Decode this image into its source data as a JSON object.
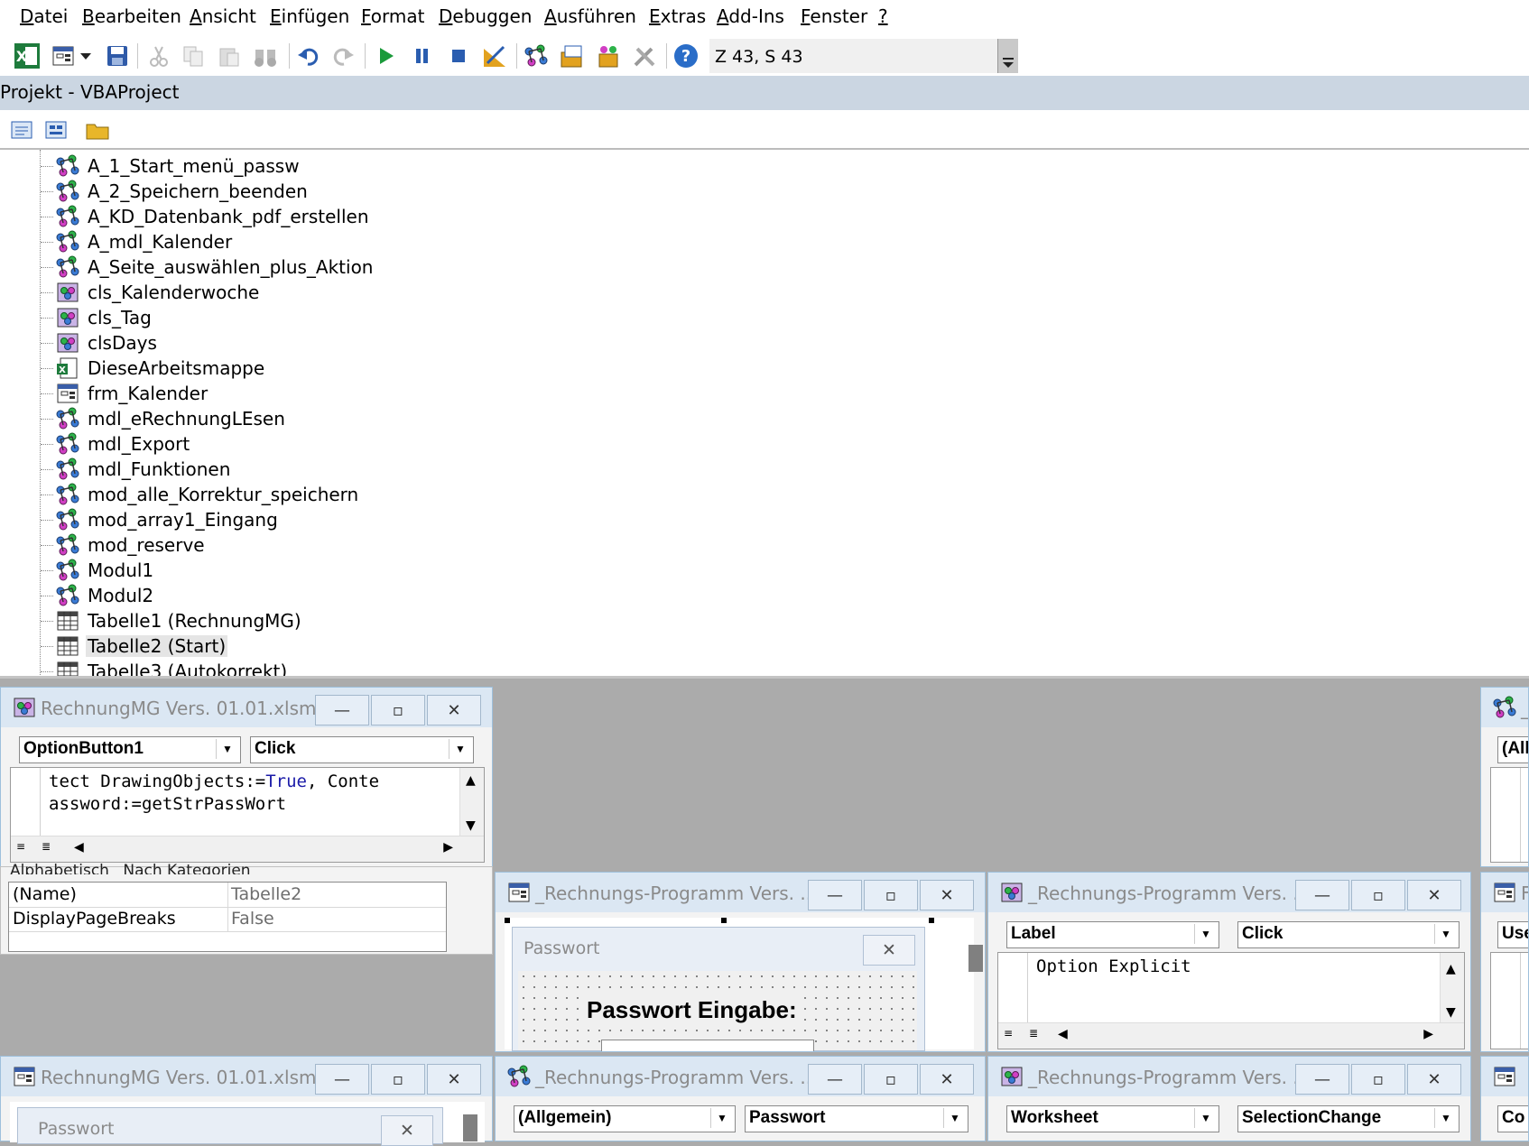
{
  "menu": [
    "Datei",
    "Bearbeiten",
    "Ansicht",
    "Einfügen",
    "Format",
    "Debuggen",
    "Ausführen",
    "Extras",
    "Add-Ins",
    "Fenster",
    "?"
  ],
  "menu_mnemonic": [
    "D",
    "B",
    "A",
    "E",
    "F",
    "D",
    "A",
    "E",
    "A",
    "F",
    "?"
  ],
  "toolbar": {
    "position": "Z 43, S 43"
  },
  "project": {
    "title": "Projekt - VBAProject",
    "items": [
      {
        "label": "A_1_Start_menü_passw",
        "icon": "module-icon"
      },
      {
        "label": "A_2_Speichern_beenden",
        "icon": "module-icon"
      },
      {
        "label": "A_KD_Datenbank_pdf_erstellen",
        "icon": "module-icon"
      },
      {
        "label": "A_mdl_Kalender",
        "icon": "module-icon"
      },
      {
        "label": "A_Seite_auswählen_plus_Aktion",
        "icon": "module-icon"
      },
      {
        "label": "cls_Kalenderwoche",
        "icon": "class-module-icon"
      },
      {
        "label": "cls_Tag",
        "icon": "class-module-icon"
      },
      {
        "label": "clsDays",
        "icon": "class-module-icon"
      },
      {
        "label": "DieseArbeitsmappe",
        "icon": "workbook-icon"
      },
      {
        "label": "frm_Kalender",
        "icon": "userform-icon"
      },
      {
        "label": "mdl_eRechnungLEsen",
        "icon": "module-icon"
      },
      {
        "label": "mdl_Export",
        "icon": "module-icon"
      },
      {
        "label": "mdl_Funktionen",
        "icon": "module-icon"
      },
      {
        "label": "mod_alle_Korrektur_speichern",
        "icon": "module-icon"
      },
      {
        "label": "mod_array1_Eingang",
        "icon": "module-icon"
      },
      {
        "label": "mod_reserve",
        "icon": "module-icon"
      },
      {
        "label": "Modul1",
        "icon": "module-icon"
      },
      {
        "label": "Modul2",
        "icon": "module-icon"
      },
      {
        "label": "Tabelle1 (RechnungMG)",
        "icon": "worksheet-icon"
      },
      {
        "label": "Tabelle2 (Start)",
        "icon": "worksheet-icon",
        "selected": true
      },
      {
        "label": "Tabelle3 (Autokorrekt)",
        "icon": "worksheet-icon"
      }
    ]
  },
  "windows": {
    "w1": {
      "title": "RechnungMG Vers. 01.01.xlsm ...",
      "object": "OptionButton1",
      "proc": "Click",
      "code": [
        "tect DrawingObjects:=",
        "True",
        ", Conte",
        "assword:=getStrPassWort"
      ]
    },
    "w2": {
      "title": "_Rechnungs-Programm Vers. ...",
      "form_caption": "Passwort",
      "form_label": "Passwort Eingabe:"
    },
    "w3": {
      "title": "_Rechnungs-Programm Vers. ...",
      "object": "Label",
      "proc": "Click",
      "code_kw": "Option Explicit"
    },
    "w4": {
      "title": "RechnungMG Vers. 01.01.xlsm ...",
      "form_caption": "Passwort"
    },
    "w5": {
      "title": "_Rechnungs-Programm Vers. ...",
      "object": "(Allgemein)",
      "proc": "Passwort"
    },
    "w6": {
      "title": "_Rechnungs-Programm Vers. ...",
      "object": "Worksheet",
      "proc": "SelectionChange"
    },
    "right": {
      "r1_combo": "(All",
      "r2_combo": "Use",
      "r3_combo": "Co",
      "r1_title": "_",
      "r2_title": "F"
    }
  },
  "properties": {
    "tabs": [
      "Alphabetisch",
      "Nach Kategorien"
    ],
    "rows": [
      {
        "k": "(Name)",
        "v": "Tabelle2"
      },
      {
        "k": "DisplayPageBreaks",
        "v": "False"
      }
    ]
  },
  "window_buttons": {
    "minimize": "—",
    "restore": "▫",
    "close": "✕"
  }
}
